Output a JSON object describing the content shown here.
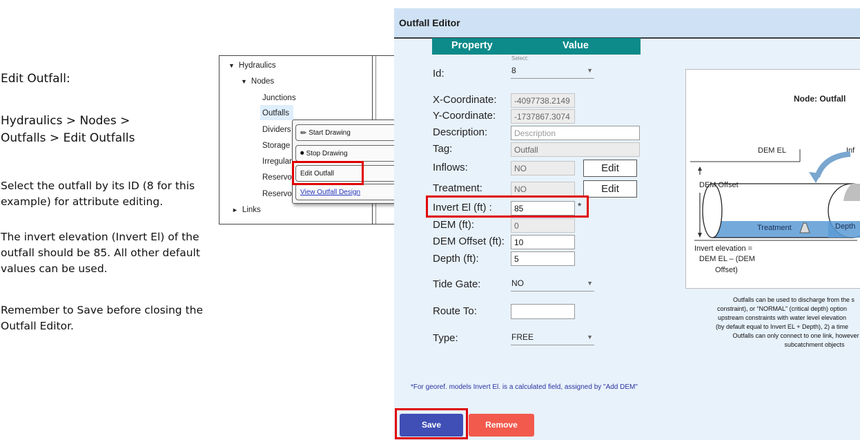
{
  "instructions": {
    "title": "Edit Outfall:",
    "path_line1": "Hydraulics > Nodes >",
    "path_line2": "Outfalls > Edit Outfalls",
    "select_line1": "Select the outfall by its ID (8 for this",
    "select_line2": "example) for attribute editing.",
    "invert_line1": "The invert elevation (Invert El) of the",
    "invert_line2": "outfall should be 85. All other default",
    "invert_line3": "values can be used.",
    "save_line1": "Remember to Save before closing the",
    "save_line2": "Outfall Editor."
  },
  "tree": {
    "hydraulics": "Hydraulics",
    "nodes": "Nodes",
    "junctions": "Junctions",
    "outfalls": "Outfalls",
    "dividers": "Dividers",
    "storage": "Storage",
    "irregular": "Irregular",
    "reservo1": "Reservo",
    "reservo2": "Reservo",
    "links": "Links"
  },
  "context_menu": {
    "start_drawing": "Start Drawing",
    "stop_drawing": "Stop Drawing",
    "edit_outfall": "Edit Outfall",
    "view_design": "View Outfall Design"
  },
  "editor": {
    "title": "Outfall Editor",
    "col_property": "Property",
    "col_value": "Value",
    "select_caption": "Select:",
    "id_label": "Id:",
    "id_value": "8",
    "x_label": "X-Coordinate:",
    "x_value": "-4097738.2149",
    "y_label": "Y-Coordinate:",
    "y_value": "-1737867.3074",
    "description_label": "Description:",
    "description_placeholder": "Description",
    "tag_label": "Tag:",
    "tag_value": "Outfall",
    "inflows_label": "Inflows:",
    "inflows_value": "NO",
    "treatment_label": "Treatment:",
    "treatment_value": "NO",
    "edit_label": "Edit",
    "invert_label": "Invert El (ft) :",
    "invert_value": "85",
    "required_mark": "*",
    "dem_label": "DEM (ft):",
    "dem_value": "0",
    "dem_offset_label": "DEM Offset (ft):",
    "dem_offset_value": "10",
    "depth_label": "Depth (ft):",
    "depth_value": "5",
    "tide_gate_label": "Tide Gate:",
    "tide_gate_value": "NO",
    "route_to_label": "Route To:",
    "route_to_value": "",
    "type_label": "Type:",
    "type_value": "FREE",
    "note": "*For georef. models Invert El. is a calculated field, assigned by \"Add DEM\"",
    "save_label": "Save",
    "remove_label": "Remove"
  },
  "diagram": {
    "title": "Node: Outfall",
    "dem_el": "DEM EL",
    "inf": "Inf",
    "dem_offset": "DEM Offset",
    "treatment": "Treatment",
    "depth": "Depth",
    "invert_line1": "Invert elevation =",
    "invert_line2": "DEM EL – (DEM",
    "invert_line3": "Offset)"
  },
  "caption": {
    "line1": "Outfalls can be used to discharge from the s",
    "line2": "constraint), or “NORMAL” (critical depth) option",
    "line3": "upstream constraints with water level elevation",
    "line4": "(by default equal to Invert EL + Depth), 2) a time",
    "line5": "Outfalls can only connect to one link, however",
    "line6": "subcatchment objects"
  },
  "colors": {
    "highlight": "#e00000",
    "table_header": "#0d8a8a",
    "save_button": "#3f4fb5",
    "remove_button": "#f25a4d",
    "editor_bg": "#e8f2fb"
  }
}
